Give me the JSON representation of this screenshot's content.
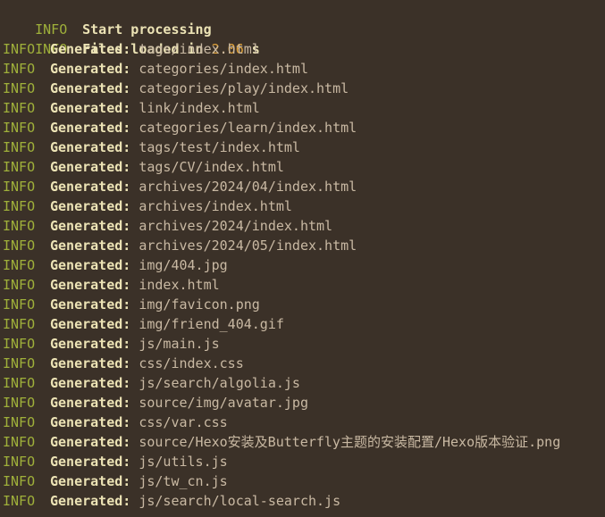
{
  "colors": {
    "background": "#3b3128",
    "info": "#9fb03a",
    "label": "#ece3b5",
    "path": "#c9b9a3",
    "number": "#e5a53a"
  },
  "header": [
    {
      "level": "INFO",
      "text": "Start processing"
    },
    {
      "level": "INFO",
      "prefix": "Files loaded in ",
      "value": "2.06",
      "suffix": " s"
    }
  ],
  "generated_label": "Generated:",
  "lines": [
    {
      "level": "INFO",
      "path": "tags/index.html"
    },
    {
      "level": "INFO",
      "path": "categories/index.html"
    },
    {
      "level": "INFO",
      "path": "categories/play/index.html"
    },
    {
      "level": "INFO",
      "path": "link/index.html"
    },
    {
      "level": "INFO",
      "path": "categories/learn/index.html"
    },
    {
      "level": "INFO",
      "path": "tags/test/index.html"
    },
    {
      "level": "INFO",
      "path": "tags/CV/index.html"
    },
    {
      "level": "INFO",
      "path": "archives/2024/04/index.html"
    },
    {
      "level": "INFO",
      "path": "archives/index.html"
    },
    {
      "level": "INFO",
      "path": "archives/2024/index.html"
    },
    {
      "level": "INFO",
      "path": "archives/2024/05/index.html"
    },
    {
      "level": "INFO",
      "path": "img/404.jpg"
    },
    {
      "level": "INFO",
      "path": "index.html"
    },
    {
      "level": "INFO",
      "path": "img/favicon.png"
    },
    {
      "level": "INFO",
      "path": "img/friend_404.gif"
    },
    {
      "level": "INFO",
      "path": "js/main.js"
    },
    {
      "level": "INFO",
      "path": "css/index.css"
    },
    {
      "level": "INFO",
      "path": "js/search/algolia.js"
    },
    {
      "level": "INFO",
      "path": "source/img/avatar.jpg"
    },
    {
      "level": "INFO",
      "path": "css/var.css"
    },
    {
      "level": "INFO",
      "path": "source/Hexo安装及Butterfly主题的安装配置/Hexo版本验证.png"
    },
    {
      "level": "INFO",
      "path": "js/utils.js"
    },
    {
      "level": "INFO",
      "path": "js/tw_cn.js"
    },
    {
      "level": "INFO",
      "path": "js/search/local-search.js"
    }
  ]
}
